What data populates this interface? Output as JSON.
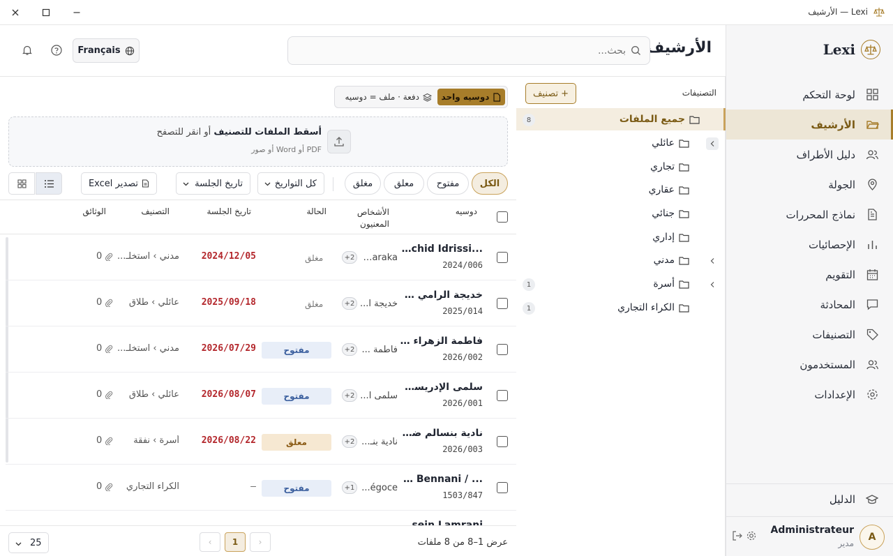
{
  "window": {
    "title": "Lexi — الأرشيف"
  },
  "sidebar": {
    "brand": "Lexi",
    "items": [
      {
        "label": "لوحة التحكم",
        "icon": "dashboard-icon"
      },
      {
        "label": "الأرشيف",
        "icon": "folder-open-icon",
        "active": true
      },
      {
        "label": "دليل الأطراف",
        "icon": "users-icon"
      },
      {
        "label": "الجولة",
        "icon": "map-pin-icon"
      },
      {
        "label": "نماذج المحررات",
        "icon": "document-icon"
      },
      {
        "label": "الإحصائيات",
        "icon": "bar-chart-icon"
      },
      {
        "label": "التقويم",
        "icon": "calendar-icon"
      },
      {
        "label": "المحادثة",
        "icon": "chat-icon"
      },
      {
        "label": "التصنيفات",
        "icon": "tag-icon"
      },
      {
        "label": "المستخدمون",
        "icon": "user-icon"
      },
      {
        "label": "الإعدادات",
        "icon": "gear-icon"
      }
    ],
    "guide": "الدليل",
    "user": {
      "initial": "A",
      "name": "Administrateur",
      "role": "مدير"
    }
  },
  "header": {
    "title": "الأرشيف",
    "search_placeholder": "بحث...",
    "language": "Français"
  },
  "categories": {
    "title": "التصنيفات",
    "add_label": "تصنيف",
    "items": [
      {
        "label": "جميع الملفات",
        "count": "8",
        "active": true
      },
      {
        "label": "عائلي",
        "expandable": true
      },
      {
        "label": "تجاري"
      },
      {
        "label": "عقاري"
      },
      {
        "label": "جنائي"
      },
      {
        "label": "إداري"
      },
      {
        "label": "مدني",
        "expandable": true
      },
      {
        "label": "أسرة",
        "expandable": true,
        "count": "1"
      },
      {
        "label": "الكراء التجاري",
        "count": "1"
      }
    ]
  },
  "mode": {
    "single": "دوسيه واحد",
    "batch": "دفعة · ملف = دوسيه"
  },
  "dropzone": {
    "title_bold": "أسقط الملفات للتصنيف",
    "title_rest": " أو انقر للتصفح",
    "subtitle": "PDF أو Word أو صور"
  },
  "filters": {
    "chips": [
      "الكل",
      "مفتوح",
      "معلق",
      "مغلق"
    ],
    "date_range": "كل التواريخ",
    "sort": "تاريخ الجلسة",
    "export": "تصدير Excel"
  },
  "table": {
    "headers": {
      "case": "دوسيه",
      "persons": "الأشخاص المعنيون",
      "status": "الحالة",
      "hearing": "تاريخ الجلسة",
      "category": "التصنيف",
      "documents": "الوثائق"
    },
    "rows": [
      {
        "title": "...c/ Rachid Idrissi",
        "number": "2024/006",
        "person": "Baraka...",
        "more": "+2",
        "status": "مغلق",
        "status_type": "closed",
        "date": "2024/12/05",
        "category": "مدني › استخلـ...",
        "docs": "0"
      },
      {
        "title": "خديجة الرامي ضد...",
        "number": "2025/014",
        "person": "خديجة ا...",
        "more": "+2",
        "status": "مغلق",
        "status_type": "closed",
        "date": "2025/09/18",
        "category": "عائلي › طلاق",
        "docs": "0"
      },
      {
        "title": "فاطمة الزهراء بنعـ...",
        "number": "2026/002",
        "person": "فاطمة ...",
        "more": "+2",
        "status": "مفتوح",
        "status_type": "open",
        "date": "2026/07/29",
        "category": "مدني › استخلـ...",
        "docs": "0"
      },
      {
        "title": "سلمى الإدريسي ...",
        "number": "2026/001",
        "person": "سلمى ا...",
        "more": "+2",
        "status": "مفتوح",
        "status_type": "open",
        "date": "2026/08/07",
        "category": "عائلي › طلاق",
        "docs": "0"
      },
      {
        "title": "نادية بنسالم ضد يـ...",
        "number": "2026/003",
        "person": "نادية بنـ...",
        "more": "+2",
        "status": "معلق",
        "status_type": "pending",
        "date": "2026/08/22",
        "category": "أسرة › نفقة",
        "docs": "0"
      },
      {
        "title": "... / Karim Bennani",
        "number": "1503/847",
        "person": "égoce...",
        "more": "+1",
        "status": "مفتوح",
        "status_type": "open",
        "date": "—",
        "category": "الكراء التجاري",
        "docs": "0"
      },
      {
        "title": "ossein Lamrani...",
        "number": "",
        "person": "",
        "more": "",
        "status": "",
        "status_type": "",
        "date": "",
        "category": "",
        "docs": ""
      }
    ]
  },
  "footer": {
    "info": "عرض 1–8 من 8 ملفات",
    "page": "1",
    "per_page": "25"
  },
  "colors": {
    "accent": "#a77d2a",
    "date": "#b3262b",
    "open": "#3b5f9e",
    "pending": "#8a5a14"
  }
}
